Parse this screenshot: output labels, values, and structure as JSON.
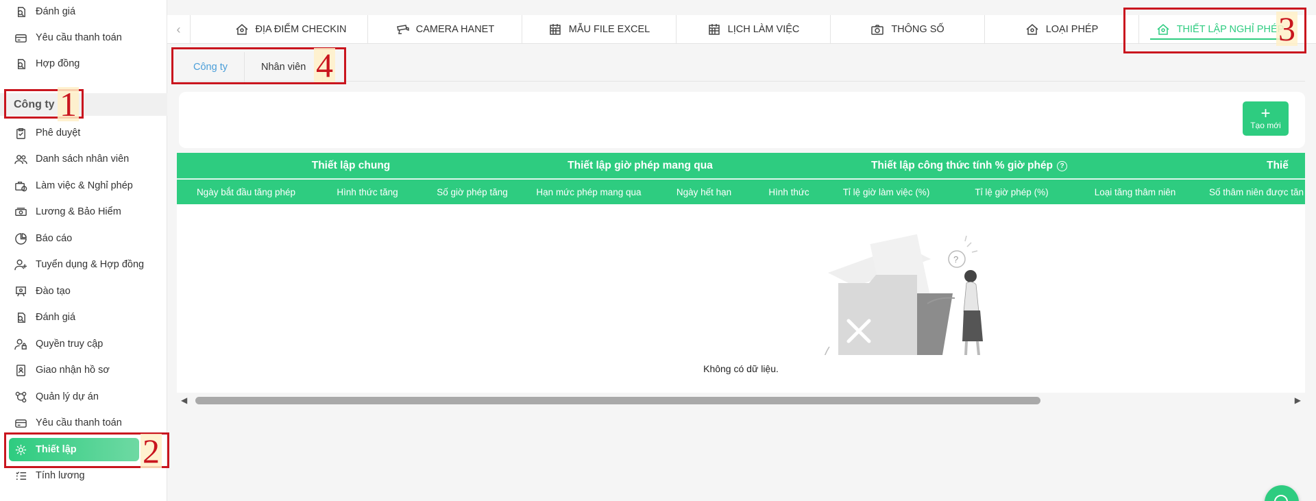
{
  "sidebar": {
    "top_items": [
      {
        "label": "Đánh giá",
        "icon": "review-icon"
      },
      {
        "label": "Yêu cầu thanh toán",
        "icon": "payment-request-icon"
      },
      {
        "label": "Hợp đồng",
        "icon": "contract-icon"
      }
    ],
    "group_label": "Công ty",
    "items": [
      {
        "label": "Phê duyệt",
        "icon": "clipboard-check-icon"
      },
      {
        "label": "Danh sách nhân viên",
        "icon": "users-icon"
      },
      {
        "label": "Làm việc & Nghỉ phép",
        "icon": "briefcase-icon"
      },
      {
        "label": "Lương & Bảo Hiểm",
        "icon": "money-icon"
      },
      {
        "label": "Báo cáo",
        "icon": "pie-chart-icon"
      },
      {
        "label": "Tuyển dụng & Hợp đồng",
        "icon": "user-plus-icon"
      },
      {
        "label": "Đào tạo",
        "icon": "training-icon"
      },
      {
        "label": "Đánh giá",
        "icon": "review-icon"
      },
      {
        "label": "Quyền truy cập",
        "icon": "user-lock-icon"
      },
      {
        "label": "Giao nhận hồ sơ",
        "icon": "id-card-icon"
      },
      {
        "label": "Quản lý dự án",
        "icon": "project-icon"
      },
      {
        "label": "Yêu cầu thanh toán",
        "icon": "payment-request-icon"
      },
      {
        "label": "Thiết lập",
        "icon": "gear-icon",
        "active": true
      },
      {
        "label": "Tính lương",
        "icon": "list-icon"
      }
    ]
  },
  "annotations": [
    "1",
    "2",
    "3",
    "4"
  ],
  "top_tabs": [
    {
      "label": "ĐỊA ĐIỂM CHECKIN",
      "icon": "location-checkin-icon"
    },
    {
      "label": "CAMERA HANET",
      "icon": "camera-icon"
    },
    {
      "label": "MẪU FILE EXCEL",
      "icon": "calendar-grid-icon"
    },
    {
      "label": "LỊCH LÀM VIỆC",
      "icon": "calendar-grid-icon"
    },
    {
      "label": "THÔNG SỐ",
      "icon": "photo-camera-icon"
    },
    {
      "label": "LOẠI PHÉP",
      "icon": "leave-type-icon"
    },
    {
      "label": "THIẾT LẬP NGHỈ PHÉP",
      "icon": "leave-setup-icon",
      "active": true
    }
  ],
  "sub_tabs": [
    {
      "label": "Công ty",
      "active": true
    },
    {
      "label": "Nhân viên"
    }
  ],
  "create_button": {
    "label": "Tạo mới"
  },
  "table": {
    "group_headers": [
      "Thiết lập chung",
      "Thiết lập giờ phép mang qua",
      "Thiết lập công thức tính % giờ phép",
      "Thiế"
    ],
    "columns": [
      "Ngày bắt đầu tăng phép",
      "Hình thức tăng",
      "Số giờ phép tăng",
      "Hạn mức phép mang qua",
      "Ngày hết hạn",
      "Hình thức",
      "Tỉ lệ giờ làm việc (%)",
      "Tỉ lệ giờ phép (%)",
      "Loại tăng thâm niên",
      "Số thâm niên được tăn"
    ],
    "empty_text": "Không có dữ liệu."
  },
  "colors": {
    "accent": "#2ecc80",
    "annotation": "#c9151e",
    "link": "#4a9ed9"
  }
}
